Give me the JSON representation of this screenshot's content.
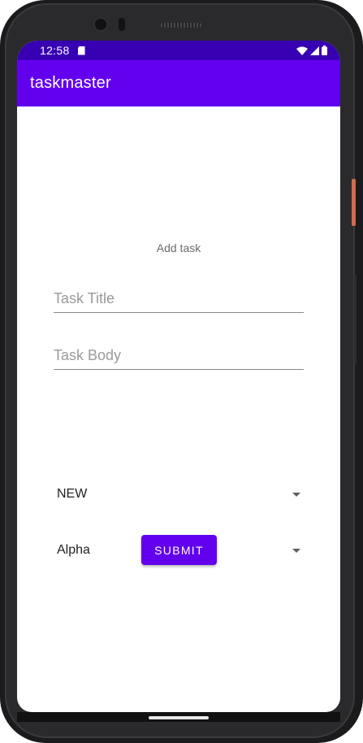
{
  "status_bar": {
    "time": "12:58",
    "icons": [
      "sd-card-icon",
      "wifi-icon",
      "signal-icon",
      "battery-icon"
    ]
  },
  "app_bar": {
    "title": "taskmaster"
  },
  "form": {
    "heading": "Add task",
    "task_title": {
      "value": "",
      "placeholder": "Task Title"
    },
    "task_body": {
      "value": "",
      "placeholder": "Task Body"
    },
    "status_select": {
      "selected": "NEW"
    },
    "team_select": {
      "selected": "Alpha"
    },
    "submit_label": "SUBMIT"
  },
  "colors": {
    "status_bar": "#3700b3",
    "app_bar": "#6200ee",
    "accent": "#6200ee"
  }
}
